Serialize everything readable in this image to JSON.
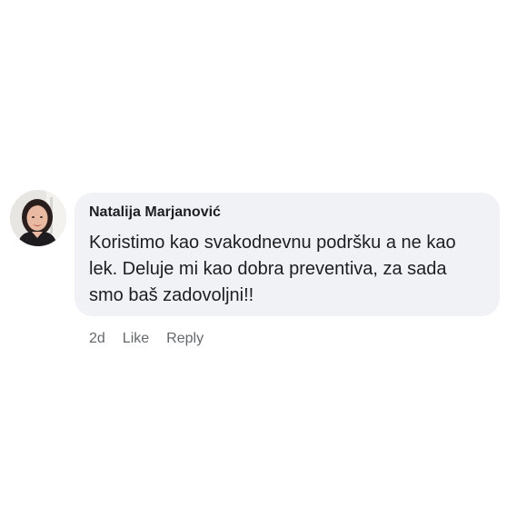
{
  "comment": {
    "author": "Natalija Marjanović",
    "text": "Koristimo kao svakodnevnu podršku a ne kao\nlek. Deluje mi kao dobra preventiva, za sada\nsmo baš zadovoljni!!",
    "time": "2d",
    "like_label": "Like",
    "reply_label": "Reply",
    "avatar_icon": "profile-photo"
  },
  "colors": {
    "bubble": "#f0f2f5",
    "text": "#1c1e21",
    "meta": "#65676b"
  }
}
